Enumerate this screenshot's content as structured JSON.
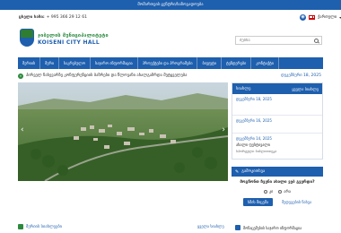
{
  "topbar": {
    "text": "მომართვის ცენტრი/საზოგადოება"
  },
  "contact": {
    "label": "ცხელი ხაზი:",
    "value": "+ 995 366 29 12 61"
  },
  "language": {
    "label": "ქართული"
  },
  "logo": {
    "title": "ჯიბელის მუნიციპალიტეტი",
    "subtitle": "KOISENI CITY HALL"
  },
  "search": {
    "placeholder": "ძებნა"
  },
  "nav": {
    "items": [
      {
        "label": "მერიის"
      },
      {
        "label": "მერი"
      },
      {
        "label": "საკრებულო"
      },
      {
        "label": "საჯარო ინფორმაცია"
      },
      {
        "label": "პროექტები და პროგრამები"
      },
      {
        "label": "ბიუჯეტი"
      },
      {
        "label": "ტენდერები"
      },
      {
        "label": "კონტაქტი"
      }
    ]
  },
  "ticker": {
    "text": "პირველ ნახევარზე კონფერენციის ბაზრები და წლოვანი ახალგაზრდა მეტყველება",
    "date": "დეკემბერი 18, 2025"
  },
  "news": {
    "title": "სიახლე",
    "all_link": "ყველა სიახლე",
    "items": [
      {
        "date": "დეკემბერი 18, 2025",
        "title": "",
        "sub": ""
      },
      {
        "date": "დეკემბერი 16, 2025",
        "title": "",
        "sub": ""
      },
      {
        "date": "დეკემბერი 14, 2025",
        "title": "ახალი ფესტივალი",
        "sub": "სპორტული ბიბლიოთეკა"
      }
    ]
  },
  "poll": {
    "title": "გამოკითხვა",
    "question": "მოგწონთ ჩვენი ახალი ვებ გვერდი?",
    "option_yes": "კი",
    "option_no": "არა",
    "vote_button": "ხმის მიცემა",
    "results_link": "შედეგების ნახვა"
  },
  "bottom": {
    "left_label": "მერიის სიახლეები",
    "more_link": "ყველა სიახლე",
    "right_label": "მონაცემების საჯარო ინფორმაცია"
  },
  "colors": {
    "brand_blue": "#1e5fae",
    "brand_green": "#2b8a3e"
  }
}
